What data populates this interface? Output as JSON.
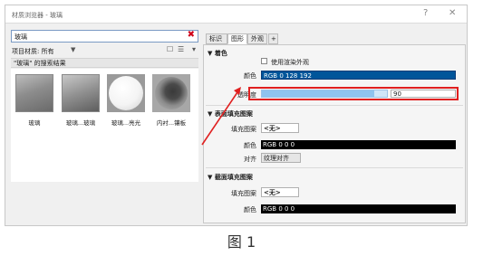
{
  "window": {
    "title": "材质浏览器 - 玻璃",
    "help_label": "?",
    "close_label": "✕"
  },
  "search": {
    "value": "玻璃",
    "clear_label": "✖"
  },
  "filter": {
    "label": "项目材质: 所有",
    "arrow": "▼"
  },
  "view_buttons": [
    "☐",
    "☰",
    "▾"
  ],
  "results": {
    "title": "\"玻璃\" 的搜索结果",
    "items": [
      {
        "label": "玻璃"
      },
      {
        "label": "玻璃...玻璃"
      },
      {
        "label": "玻璃...亮光"
      },
      {
        "label": "内衬...镶板"
      }
    ]
  },
  "tabs": [
    {
      "label": "标识",
      "active": false
    },
    {
      "label": "图形",
      "active": true
    },
    {
      "label": "外观",
      "active": false
    },
    {
      "label": "+",
      "active": false
    }
  ],
  "shading": {
    "title": "▼ 着色",
    "use_render_label": "使用渲染外观",
    "color_label": "颜色",
    "color_value": "RGB 0 128 192",
    "transparency_label": "透明度",
    "transparency_value": "90",
    "transparency_fraction": 0.9
  },
  "surface_pattern": {
    "title": "▼ 表面填充图案",
    "fill_label": "填充图案",
    "fill_value": "<无>",
    "color_label": "颜色",
    "color_value": "RGB 0 0 0",
    "align_label": "对齐",
    "align_value": "纹理对齐"
  },
  "cut_pattern": {
    "title": "▼ 截面填充图案",
    "fill_label": "填充图案",
    "fill_value": "<无>",
    "color_label": "颜色",
    "color_value": "RGB 0 0 0"
  },
  "caption": "图 1",
  "colors": {
    "accent_blue": "#00559a",
    "highlight_red": "#e02020",
    "slider_fill": "#8fc3ee"
  }
}
